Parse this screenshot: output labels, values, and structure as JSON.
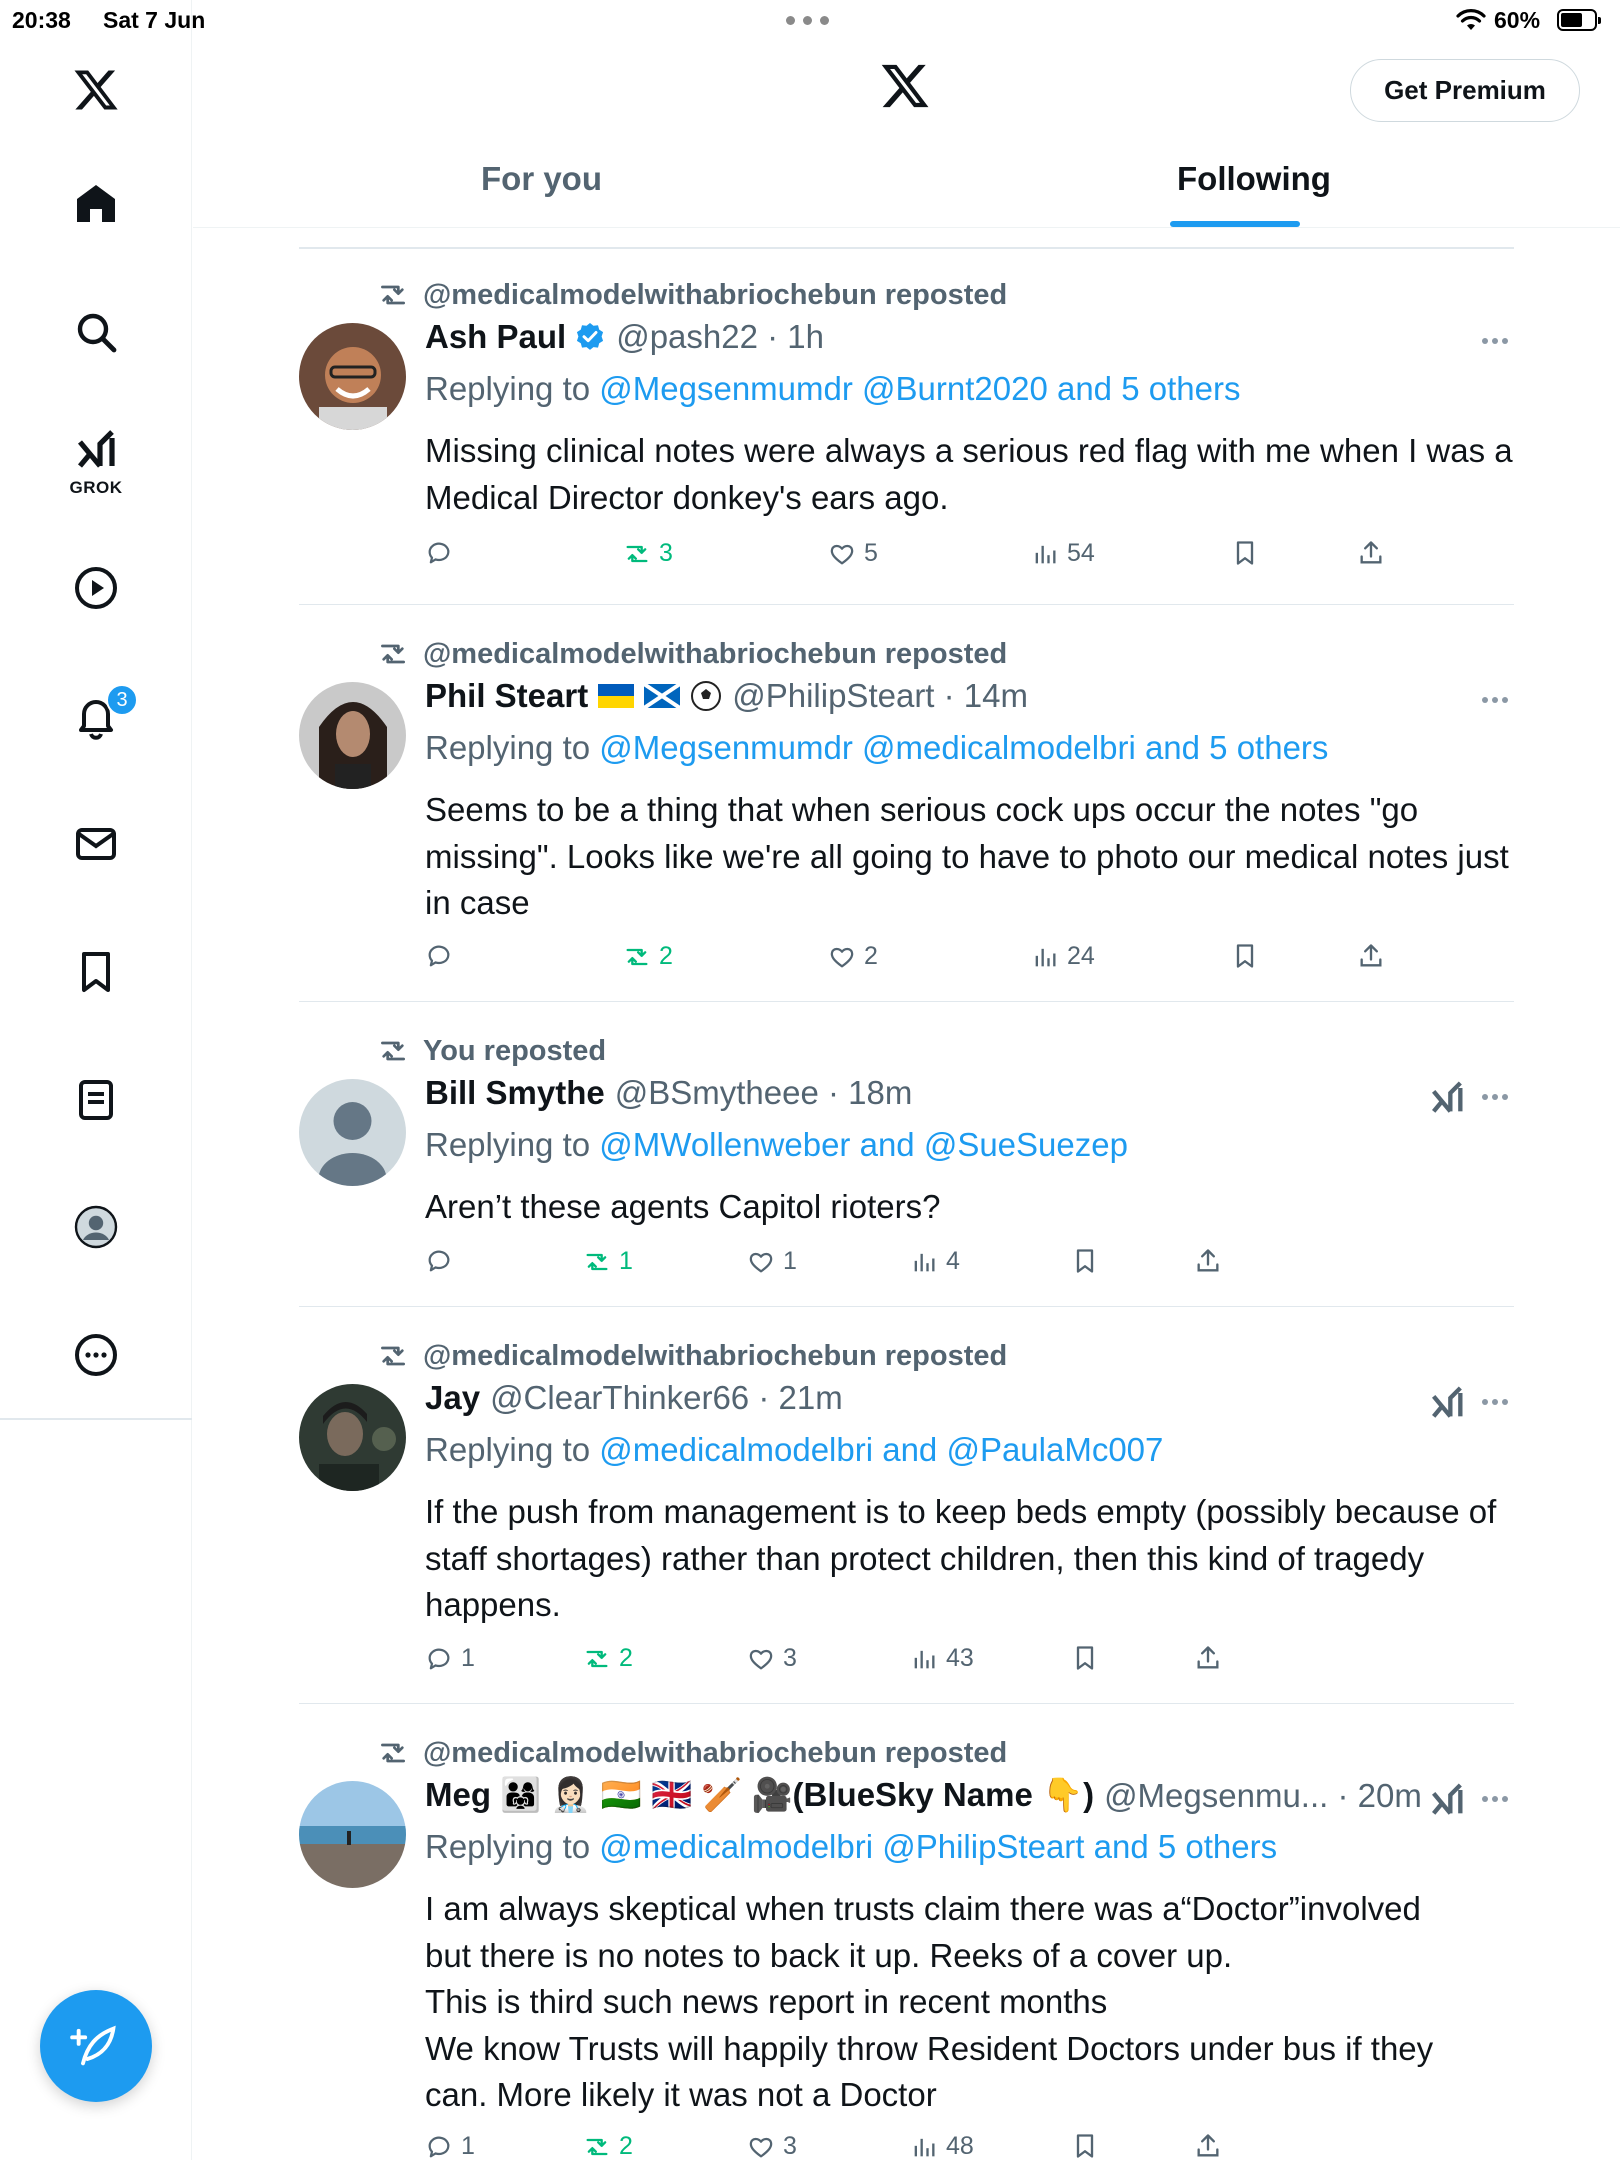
{
  "status_bar": {
    "time": "20:38",
    "date": "Sat 7 Jun",
    "battery": "60%"
  },
  "sidebar": {
    "grok_label": "GROK",
    "notification_count": "3"
  },
  "header": {
    "premium_label": "Get Premium",
    "tabs": [
      {
        "label": "For you",
        "active": false
      },
      {
        "label": "Following",
        "active": true
      }
    ]
  },
  "posts": [
    {
      "repost_by": "@medicalmodelwithabriochebun reposted",
      "name": "Ash Paul",
      "verified": true,
      "handle": "@pash22 · 1h",
      "reply_prefix": "Replying to",
      "reply_links": "@Megsenmumdr @Burnt2020 and 5 others",
      "text": "Missing clinical notes were always a serious red flag with me when I was a Medical Director donkey's ears ago.",
      "replies": "",
      "reposts": "3",
      "likes": "5",
      "views": "54"
    },
    {
      "repost_by": "@medicalmodelwithabriochebun reposted",
      "name": "Phil Steart",
      "flags": "🇺🇦 🏴󠁧󠁢󠁳󠁣󠁴󠁿 ⚽",
      "handle": "@PhilipSteart · 14m",
      "reply_prefix": "Replying to",
      "reply_links": "@Megsenmumdr @medicalmodelbri and 5 others",
      "text": "Seems to be a thing that when serious cock ups occur the notes \"go missing\". Looks like we're all going to have to photo our medical notes just in case",
      "replies": "",
      "reposts": "2",
      "likes": "2",
      "views": "24"
    },
    {
      "repost_by": "You reposted",
      "name": "Bill Smythe",
      "handle": "@BSmytheee · 18m",
      "reply_prefix": "Replying to",
      "reply_links": "@MWollenweber and @SueSuezep",
      "text": "Aren’t these agents Capitol rioters?",
      "replies": "",
      "reposts": "1",
      "likes": "1",
      "views": "4"
    },
    {
      "repost_by": "@medicalmodelwithabriochebun reposted",
      "name": "Jay",
      "handle": "@ClearThinker66 · 21m",
      "reply_prefix": "Replying to",
      "reply_links": "@medicalmodelbri and @PaulaMc007",
      "text": "If the push from management is to keep beds empty (possibly because of staff shortages) rather than protect children, then this kind of tragedy happens.",
      "replies": "1",
      "reposts": "2",
      "likes": "3",
      "views": "43"
    },
    {
      "repost_by": "@medicalmodelwithabriochebun reposted",
      "name": "Meg 👨‍👩‍👧 👩🏻‍⚕️ 🇮🇳 🇬🇧 🏏 🎥(BlueSky Name 👇)",
      "handle": "@Megsenmu... · 20m",
      "reply_prefix": "Replying to",
      "reply_links": "@medicalmodelbri @PhilipSteart and 5 others",
      "text": "I am always skeptical when trusts claim there was a“Doctor”involved but there is no notes to back it up. Reeks of a cover up. This is third such news report in recent months We know Trusts will happily throw Resident Doctors under bus if they can. More likely it was not a Doctor",
      "text_lines": [
        "I am always skeptical when trusts claim there was a“Doctor”involved",
        "but there is no notes to back it up. Reeks of a cover up.",
        "This is third such news report in recent months",
        "We know Trusts will happily throw Resident Doctors under bus if they",
        "can. More likely it was not a Doctor"
      ],
      "replies": "1",
      "reposts": "2",
      "likes": "3",
      "views": "48"
    }
  ],
  "colors": {
    "accent": "#1d9bf0",
    "repost_green": "#00ba7c",
    "secondary_text": "#536471",
    "primary_text": "#0f1419"
  }
}
